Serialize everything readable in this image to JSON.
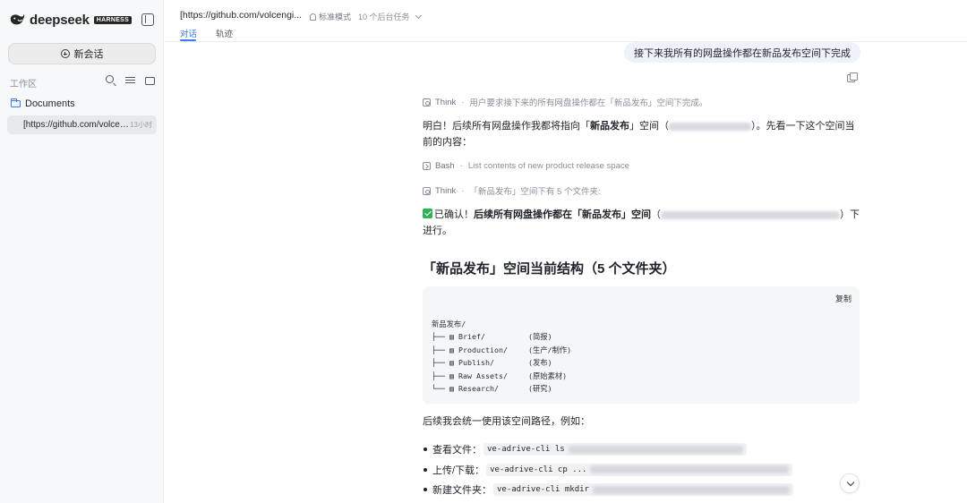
{
  "sidebar": {
    "brand": {
      "name": "deepseek",
      "badge": "HARNESS"
    },
    "new_chat_label": "新会话",
    "workspace_label": "工作区",
    "tree": {
      "folder": "Documents"
    },
    "sessions": [
      {
        "title": "[https://github.com/volcengi...",
        "time": "13小时"
      }
    ]
  },
  "header": {
    "title": "[https://github.com/volcengi...",
    "mode_label": "标准模式",
    "tasks_label": "10 个后台任务",
    "tabs": [
      {
        "label": "对话",
        "active": true
      },
      {
        "label": "轨迹",
        "active": false
      }
    ]
  },
  "conversation": {
    "user_message": "接下来我所有的网盘操作都在新品发布空间下完成",
    "steps": [
      {
        "type": "Think",
        "text": "用户要求接下来的所有网盘操作都在「新品发布」空间下完成。"
      },
      {
        "type": "Bash",
        "text": "List contents of new product release space"
      },
      {
        "type": "Think",
        "text": "「新品发布」空间下有 5 个文件夹:"
      }
    ],
    "para1": {
      "prefix": "明白！后续所有网盘操作我都将指向「",
      "bold": "新品发布",
      "mid": "」空间（",
      "suffix": "）。先看一下这个空间当前的内容："
    },
    "para2": {
      "prefix": "已确认！",
      "bold": "后续所有网盘操作都在「新品发布」空间",
      "mid": "（",
      "suffix": "）下进行。"
    },
    "heading": "「新品发布」空间当前结构（5 个文件夹）",
    "code": {
      "copy_label": "复制",
      "root": "新品发布/",
      "lines": [
        {
          "branch": "├──",
          "name": "Brief/",
          "note": "(简报)"
        },
        {
          "branch": "├──",
          "name": "Production/",
          "note": "(生产/制作)"
        },
        {
          "branch": "├──",
          "name": "Publish/",
          "note": "(发布)"
        },
        {
          "branch": "├──",
          "name": "Raw Assets/",
          "note": "(原始素材)"
        },
        {
          "branch": "└──",
          "name": "Research/",
          "note": "(研究)"
        }
      ]
    },
    "usage_intro": "后续我会统一使用该空间路径，例如：",
    "examples": [
      {
        "label": "查看文件：",
        "cmd": "ve-adrive-cli ls"
      },
      {
        "label": "上传/下载：",
        "cmd": "ve-adrive-cli cp ..."
      },
      {
        "label": "新建文件夹：",
        "cmd": "ve-adrive-cli mkdir"
      }
    ]
  },
  "colors": {
    "accent": "#3b7cf0",
    "user_bubble": "#eef2fb",
    "success": "#2db356"
  }
}
